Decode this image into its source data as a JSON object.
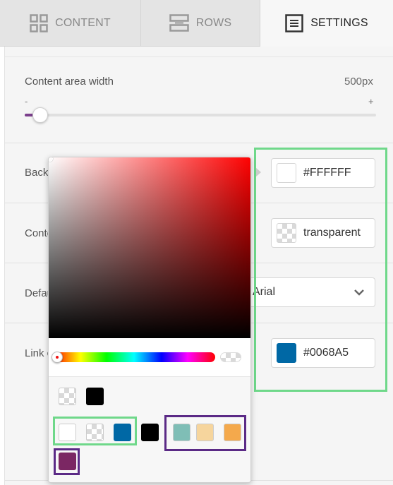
{
  "tabs": [
    {
      "label": "CONTENT",
      "icon": "grid-icon"
    },
    {
      "label": "ROWS",
      "icon": "rows-icon"
    },
    {
      "label": "SETTINGS",
      "icon": "settings-list-icon"
    }
  ],
  "settings": {
    "content_area_width": {
      "label": "Content area width",
      "value": "500px",
      "min_label": "-",
      "max_label": "+"
    },
    "background": {
      "label": "Backg",
      "value": "#FFFFFF",
      "swatch": "#FFFFFF"
    },
    "content_bg": {
      "label": "Conte",
      "value": "transparent"
    },
    "default_font": {
      "label": "Defau",
      "value": "Arial"
    },
    "link_color": {
      "label": "Link c",
      "value": "#0068A5",
      "swatch": "#0068A5"
    }
  },
  "picker": {
    "base_hue": "#FF0000",
    "swatches_row1": [
      "transparent",
      "#000000"
    ],
    "swatches_row2": [
      "#FFFFFF",
      "transparent",
      "#0068A5",
      "#000000",
      "#7FBEB6",
      "#F6D59D",
      "#F4A94C"
    ],
    "swatches_row3": [
      "#7B2763"
    ]
  },
  "colors": {
    "highlight_green": "#6FD88A",
    "highlight_purple": "#5B2A86",
    "slider_accent": "#7B3F8C"
  }
}
